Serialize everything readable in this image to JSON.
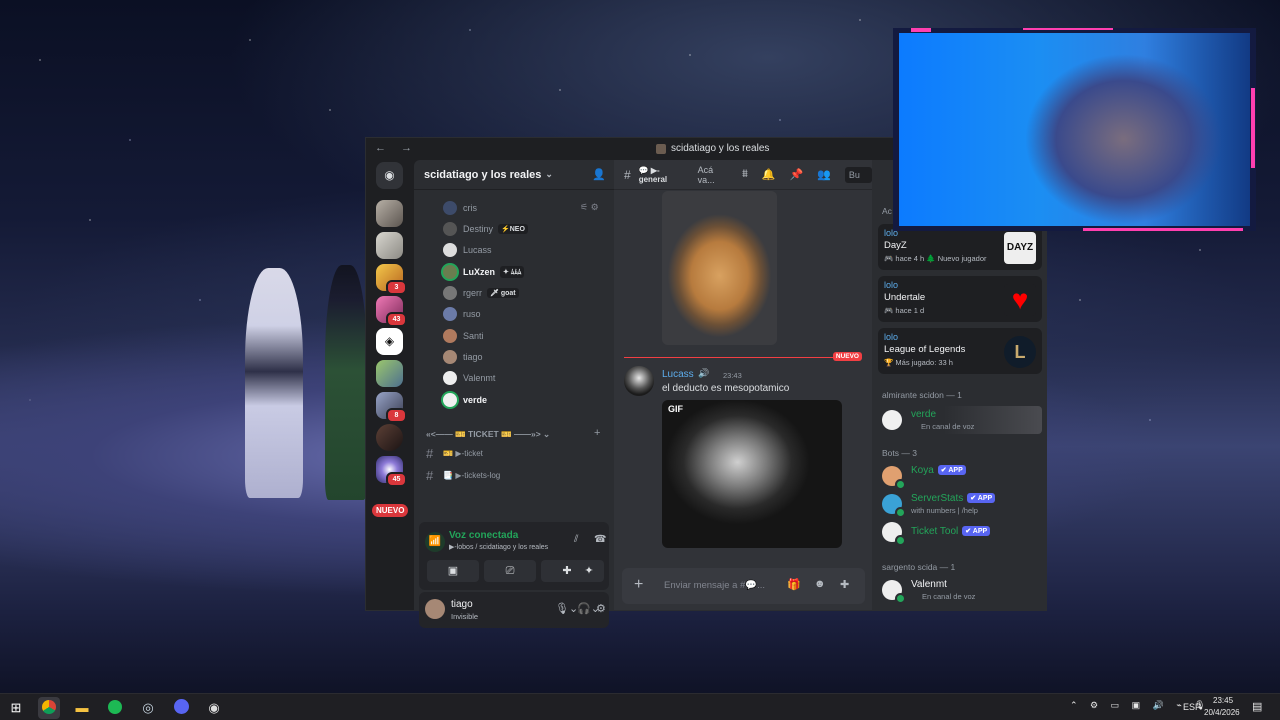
{
  "window": {
    "title": "scidatiago y los reales",
    "nav": "← →"
  },
  "guild": {
    "name": "scidatiago y los reales"
  },
  "servers": [
    {
      "badge": ""
    },
    {
      "badge": ""
    },
    {
      "badge": "3"
    },
    {
      "badge": "43"
    },
    {
      "badge": ""
    },
    {
      "badge": ""
    },
    {
      "badge": "8"
    },
    {
      "badge": ""
    },
    {
      "badge": "45"
    }
  ],
  "nuevo_pill": "NUEVO",
  "voice_members": [
    {
      "name": "cris",
      "tag": ""
    },
    {
      "name": "Destiny",
      "tag": "⚡NEO"
    },
    {
      "name": "Lucass",
      "tag": ""
    },
    {
      "name": "LuXzen",
      "tag": "✦ ﾑﾑﾑ"
    },
    {
      "name": "rgerr",
      "tag": "🗡 goat"
    },
    {
      "name": "ruso",
      "tag": ""
    },
    {
      "name": "Santi",
      "tag": ""
    },
    {
      "name": "tiago",
      "tag": ""
    },
    {
      "name": "Valenmt",
      "tag": ""
    },
    {
      "name": "verde",
      "tag": ""
    }
  ],
  "category": "«<—— 🎫 TICKET 🎫 ——»> ⌄",
  "channels": [
    {
      "name": "🎫 ▶-ticket"
    },
    {
      "name": "📑 ▶-tickets-log"
    }
  ],
  "voice_panel": {
    "title": "Voz conectada",
    "sub": "▶-lobos / scidatiago y los reales"
  },
  "user_panel": {
    "name": "tiago",
    "status": "Invisible"
  },
  "chat": {
    "channel": "💬 ▶-general",
    "topic": "Acá va...",
    "search": "Bu",
    "new_label": "NUEVO",
    "message": {
      "author": "Lucass",
      "time": "23:43",
      "text": "el deducto es mesopotamico",
      "gif": "GIF"
    },
    "composer_placeholder": "Enviar mensaje a #💬..."
  },
  "activity": {
    "header": "Ac",
    "cards": [
      {
        "user": "lolo",
        "game": "DayZ",
        "meta": "🎮 hace 4 h   🌲 Nuevo jugador",
        "logo": "DAYZ"
      },
      {
        "user": "lolo",
        "game": "Undertale",
        "meta": "🎮 hace 1 d",
        "logo": ""
      },
      {
        "user": "lolo",
        "game": "League of Legends",
        "meta": "🏆 Más jugado: 33 h",
        "logo": "L"
      }
    ]
  },
  "groups": {
    "almirante": {
      "title": "almirante scidon — 1",
      "members": [
        {
          "name": "verde",
          "sub": "En canal de voz"
        }
      ]
    },
    "bots": {
      "title": "Bots — 3",
      "members": [
        {
          "name": "Koya",
          "sub": "",
          "app": "✔ APP"
        },
        {
          "name": "ServerStats",
          "sub": "with numbers | /help",
          "app": "✔ APP"
        },
        {
          "name": "Ticket Tool",
          "sub": "",
          "app": "✔ APP"
        }
      ]
    },
    "sargento": {
      "title": "sargento scida — 1",
      "members": [
        {
          "name": "Valenmt",
          "sub": "En canal de voz"
        }
      ]
    }
  },
  "taskbar": {
    "lang": "ESP",
    "time": "23:45",
    "date": "20/4/2026"
  },
  "colors": {
    "accent": "#5865f2",
    "danger": "#da373c",
    "voice_green": "#23a55a",
    "cam_border": "#ff3fb0"
  }
}
